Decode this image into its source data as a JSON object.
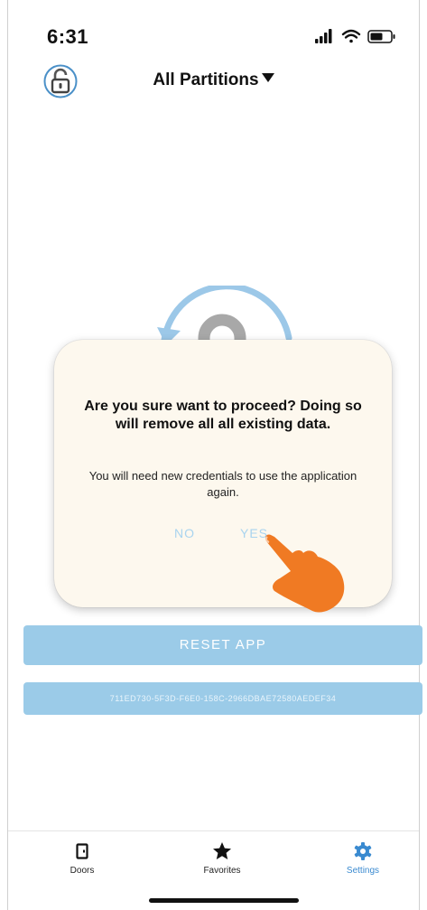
{
  "status_bar": {
    "time": "6:31"
  },
  "header": {
    "title": "All Partitions",
    "lock_icon": "unlocked-padlock-icon"
  },
  "dialog": {
    "title": "Are you sure want to proceed? Doing so will remove all all existing data.",
    "message": "You will need new credentials to use the application again.",
    "no_label": "NO",
    "yes_label": "YES",
    "button_color": "#a9d4ef",
    "background": "#fdf8ee"
  },
  "reset": {
    "label": "RESET APP",
    "color": "#9bcbe8"
  },
  "device_id": "711ED730-5F3D-F6E0-158C-2966DBAE72580AEDEF34",
  "tabs": [
    {
      "label": "Doors",
      "icon": "door-icon",
      "active": false
    },
    {
      "label": "Favorites",
      "icon": "star-icon",
      "active": false
    },
    {
      "label": "Settings",
      "icon": "gear-icon",
      "active": true
    }
  ],
  "colors": {
    "accent": "#3a8ad0",
    "hand": "#f07a23"
  }
}
